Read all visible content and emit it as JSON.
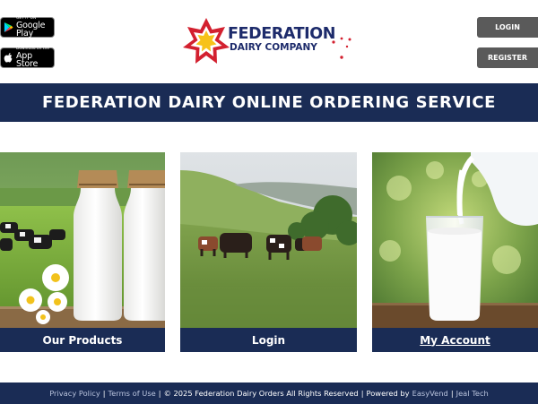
{
  "header": {
    "google_play": {
      "small": "GET IT ON",
      "big": "Google Play"
    },
    "app_store": {
      "small": "Download on the",
      "big": "App Store"
    },
    "logo": {
      "line1": "FEDERATION",
      "line2": "DAIRY COMPANY"
    },
    "login_label": "LOGIN",
    "register_label": "REGISTER"
  },
  "banner": {
    "title": "FEDERATION DAIRY ONLINE ORDERING SERVICE"
  },
  "cards": [
    {
      "label": "Our Products"
    },
    {
      "label": "Login"
    },
    {
      "label": "My Account"
    }
  ],
  "footer": {
    "privacy": "Privacy Policy",
    "sep": "|",
    "terms": "Terms of Use",
    "copyright": "© 2025 Federation Dairy Orders All Rights Reserved",
    "powered": "Powered by",
    "easyvend": "EasyVend",
    "jeal": "Jeal Tech"
  },
  "colors": {
    "navy": "#1a2c55",
    "logo_red": "#d3202f",
    "logo_blue": "#1d2b6b",
    "button_gray": "#5a5a5a"
  }
}
